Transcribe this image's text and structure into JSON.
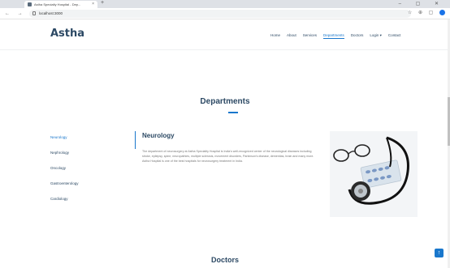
{
  "browser": {
    "tab_title": "Astha Specialty Hospital - Dep...",
    "tab_close": "×",
    "new_tab": "+",
    "window_controls": "– ▢ ✕",
    "nav_buttons": "← → ⟳",
    "url": "localhost:3000",
    "ext_icons": "☆ ⊕ ▢"
  },
  "header": {
    "logo": "Astha",
    "nav": [
      "Home",
      "About",
      "Services",
      "Departments",
      "Doctors",
      "Login ▾",
      "Contact"
    ],
    "active_nav_index": 3
  },
  "departments": {
    "title": "Departments",
    "items": [
      "Neurology",
      "Nephrology",
      "Oncology",
      "Gastroenterology",
      "Cardiology"
    ],
    "active_index": 0,
    "content": {
      "heading": "Neurology",
      "text": "The department of neurosurgery at Astha Speciality Hospital is India's well-recognized center of the neurological diseases including stroke, epilepsy, spine, neuropathies, multiple sclerosis, movement disorders, Parkinson's disease, dementias, brain and many more. Astha Hospital is one of the best hospitals for neurosurgery treatment in India."
    }
  },
  "doctors": {
    "title": "Doctors"
  },
  "scroll_top_icon": "↑",
  "colors": {
    "accent": "#1977cc",
    "heading": "#2c4964",
    "body_text": "#777777"
  }
}
